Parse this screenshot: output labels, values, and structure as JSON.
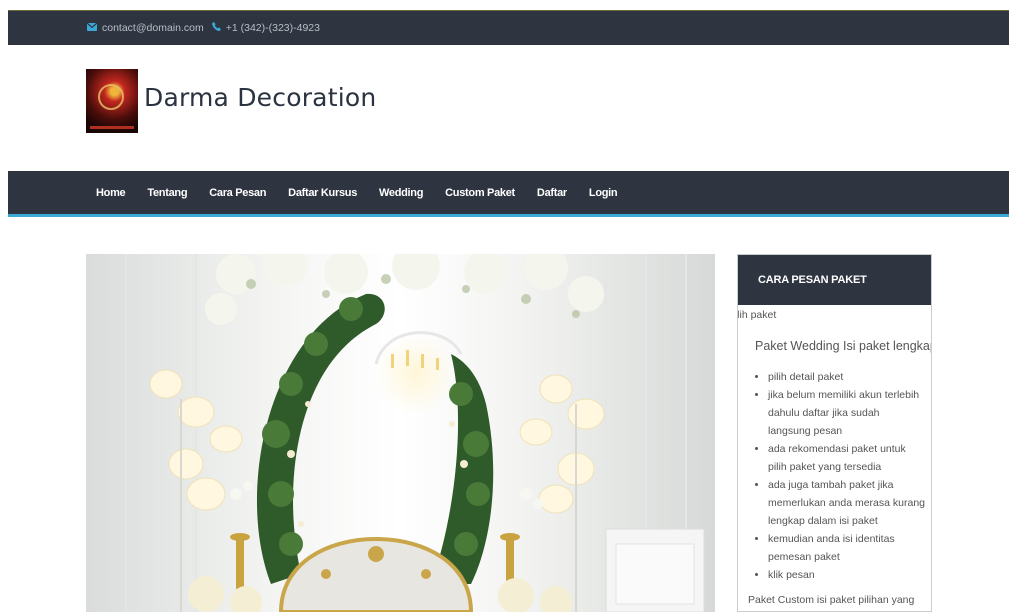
{
  "topbar": {
    "email": "contact@domain.com",
    "phone": "+1 (342)-(323)-4923"
  },
  "header": {
    "brand": "Darma Decoration"
  },
  "nav": {
    "items": [
      "Home",
      "Tentang",
      "Cara Pesan",
      "Daftar Kursus",
      "Wedding",
      "Custom Paket",
      "Daftar",
      "Login"
    ]
  },
  "sidebar": {
    "title": "CARA PESAN PAKET",
    "intro": "pilih paket",
    "subtitle": "Paket Wedding  Isi paket lengkap",
    "steps": [
      "pilih detail paket",
      "jika belum memiliki akun terlebih dahulu daftar jika sudah langsung pesan",
      "ada rekomendasi paket untuk pilih paket yang tersedia",
      "ada juga tambah paket jika memerlukan anda merasa kurang lengkap dalam isi paket",
      "kemudian anda isi identitas pemesan paket",
      "klik pesan"
    ],
    "tail": "Paket Custom isi paket pilihan yang"
  },
  "colors": {
    "dark": "#2e3541",
    "accent": "#3aa9d6"
  }
}
